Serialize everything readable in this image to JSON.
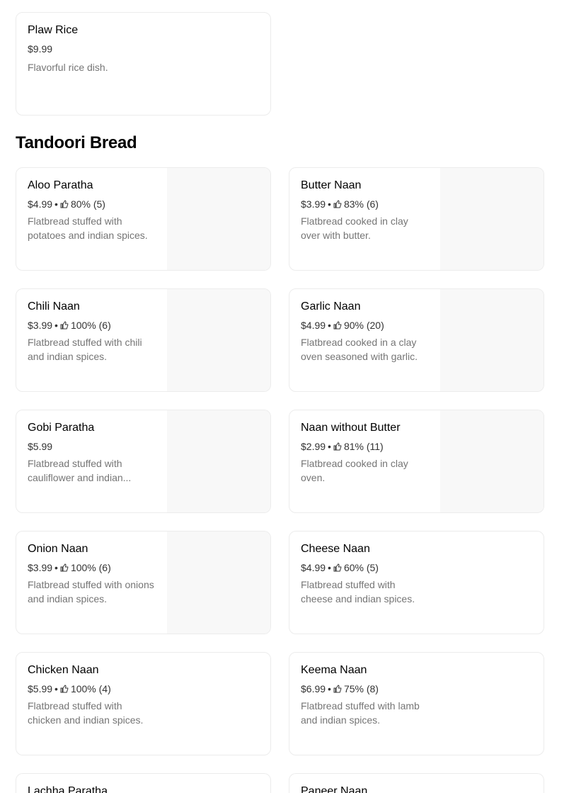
{
  "previous_item": {
    "name": "Plaw Rice",
    "price": "$9.99",
    "description": "Flavorful rice dish."
  },
  "section": {
    "title": "Tandoori Bread",
    "items": [
      {
        "name": "Aloo Paratha",
        "price": "$4.99",
        "rating": "80% (5)",
        "description": "Flatbread stuffed with potatoes and indian spices."
      },
      {
        "name": "Butter Naan",
        "price": "$3.99",
        "rating": "83% (6)",
        "description": "Flatbread cooked in clay over with butter."
      },
      {
        "name": "Chili Naan",
        "price": "$3.99",
        "rating": "100% (6)",
        "description": "Flatbread stuffed with chili and indian spices."
      },
      {
        "name": "Garlic Naan",
        "price": "$4.99",
        "rating": "90% (20)",
        "description": "Flatbread cooked in a clay oven seasoned with garlic."
      },
      {
        "name": "Gobi Paratha",
        "price": "$5.99",
        "rating": "",
        "description": "Flatbread stuffed with cauliflower and indian..."
      },
      {
        "name": "Naan without Butter",
        "price": "$2.99",
        "rating": "81% (11)",
        "description": "Flatbread cooked in clay oven."
      },
      {
        "name": "Onion Naan",
        "price": "$3.99",
        "rating": "100% (6)",
        "description": "Flatbread stuffed with onions and indian spices."
      },
      {
        "name": "Cheese Naan",
        "price": "$4.99",
        "rating": "60% (5)",
        "description": "Flatbread stuffed with cheese and indian spices."
      },
      {
        "name": "Chicken Naan",
        "price": "$5.99",
        "rating": "100% (4)",
        "description": "Flatbread stuffed with chicken and indian spices."
      },
      {
        "name": "Keema Naan",
        "price": "$6.99",
        "rating": "75% (8)",
        "description": "Flatbread stuffed with lamb and indian spices."
      },
      {
        "name": "Lachha Paratha",
        "price": "",
        "rating": "",
        "description": ""
      },
      {
        "name": "Paneer Naan",
        "price": "",
        "rating": "",
        "description": ""
      }
    ]
  },
  "icons": {
    "rating": "thumbs-up-icon"
  },
  "separator": "•"
}
